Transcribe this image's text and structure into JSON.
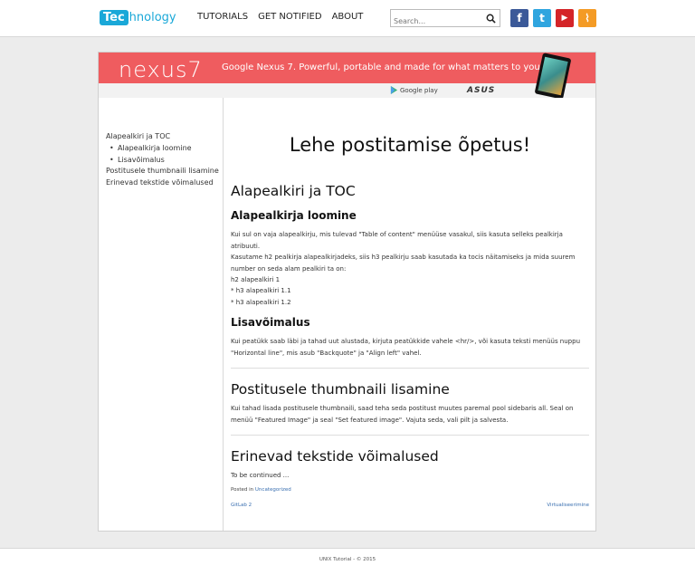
{
  "header": {
    "logo": {
      "part1": "Tec",
      "part2": "hnology"
    },
    "nav": [
      "TUTORIALS",
      "GET NOTIFIED",
      "ABOUT"
    ],
    "search": {
      "placeholder": "Search..."
    },
    "social": [
      {
        "icon": "facebook-icon",
        "glyph": "f",
        "color": "#3b5998"
      },
      {
        "icon": "twitter-icon",
        "glyph": "t",
        "color": "#2fa5df"
      },
      {
        "icon": "youtube-icon",
        "glyph": "▶",
        "color": "#d42428"
      },
      {
        "icon": "rss-icon",
        "glyph": "⌇",
        "color": "#f49b25"
      }
    ]
  },
  "banner": {
    "brand": "nexus7",
    "tagline": "Google Nexus 7. Powerful, portable and made for what matters to you.",
    "store": "Google play",
    "maker": "ASUS"
  },
  "sidebar": {
    "toc": [
      {
        "label": "Alapealkiri ja TOC",
        "sub": false
      },
      {
        "label": "Alapealkirja loomine",
        "sub": true
      },
      {
        "label": "Lisavõimalus",
        "sub": true
      },
      {
        "label": "Postitusele thumbnaili lisamine",
        "sub": false
      },
      {
        "label": "Erinevad tekstide võimalused",
        "sub": false
      }
    ]
  },
  "post": {
    "title": "Lehe postitamise õpetus!",
    "s1_h2": "Alapealkiri ja TOC",
    "s1_h3a": "Alapealkirja loomine",
    "s1_p1": "Kui sul on vaja alapealkirju, mis tulevad \"Table of content\" menüüse vasakul, siis kasuta selleks pealkirja atribuuti.",
    "s1_p2": "Kasutame h2 pealkirja alapealkirjadeks, siis h3 pealkirju saab kasutada ka tocis näitamiseks ja mida suurem number on seda alam pealkiri ta on:",
    "s1_list": [
      "h2 alapealkiri 1",
      "* h3 alapealkiri 1.1",
      "* h3 alapealkiri 1.2"
    ],
    "s1_h3b": "Lisavõimalus",
    "s1_p3": "Kui peatükk saab läbi ja tahad uut alustada, kirjuta peatükkide vahele <hr/>, või kasuta teksti menüüs nuppu \"Horizontal line\", mis asub \"Backquote\" ja \"Align left\" vahel.",
    "s2_h2": "Postitusele thumbnaili lisamine",
    "s2_p": "Kui tahad lisada postitusele thumbnaili, saad teha seda postitust muutes paremal pool sidebaris all. Seal on menüü \"Featured Image\" ja seal \"Set featured image\". Vajuta seda, vali pilt ja salvesta.",
    "s3_h2": "Erinevad tekstide võimalused",
    "s3_p": "To be continued ...",
    "posted_in_label": "Posted in",
    "category": "Uncategorized",
    "prev": "GitLab 2",
    "next": "Virtualiseerimine"
  },
  "footer": {
    "text": "UNIX Tutorial - © 2015"
  }
}
